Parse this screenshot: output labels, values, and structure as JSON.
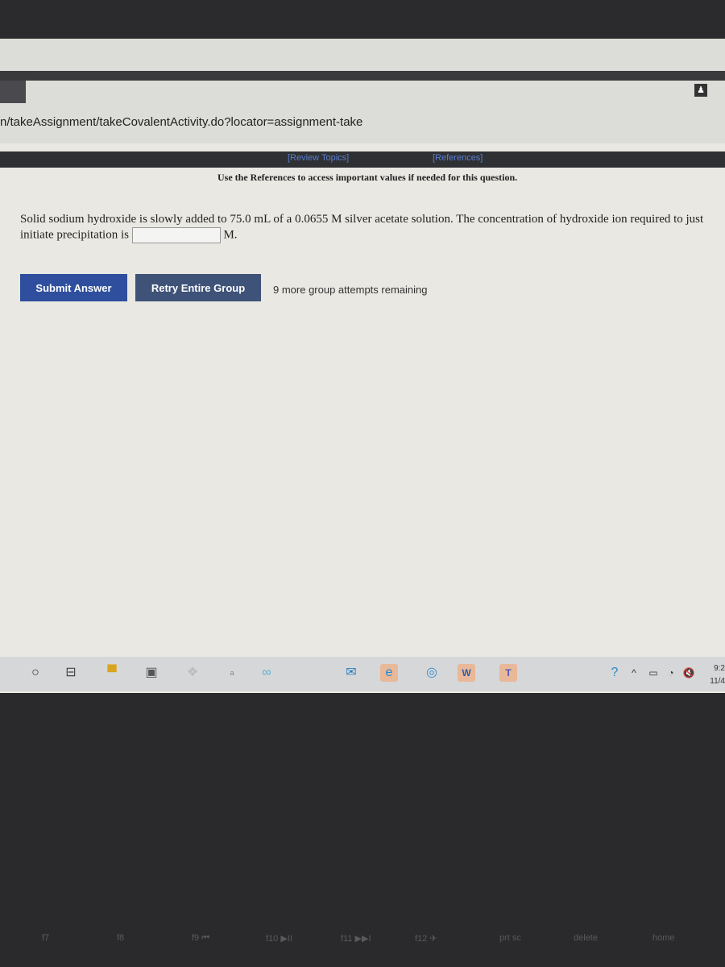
{
  "browser": {
    "url": "n/takeAssignment/takeCovalentActivity.do?locator=assignment-take"
  },
  "nav": {
    "review_topics": "[Review Topics]",
    "references": "[References]"
  },
  "notice": "Use the References to access important values if needed for this question.",
  "question": {
    "text": "Solid sodium hydroxide is slowly added to 75.0 mL of a 0.0655 M silver acetate solution. The concentration of hydroxide ion required to just initiate precipitation is",
    "answer_value": "",
    "unit": "M."
  },
  "buttons": {
    "submit": "Submit Answer",
    "retry": "Retry Entire Group"
  },
  "attempts": "9 more group attempts remaining",
  "taskbar": {
    "clock_time": "9:2",
    "clock_date": "11/4",
    "icons": [
      "cortana-icon",
      "task-view-icon",
      "file-explorer-icon",
      "store-icon",
      "dropbox-icon",
      "app-icon",
      "link-icon",
      "mail-icon",
      "edge-icon",
      "chrome-icon",
      "word-icon",
      "teams-icon"
    ]
  },
  "keyboard": {
    "keys": [
      "f7",
      "f8",
      "f9 ⏮",
      "f10 ▶II",
      "f11 ▶▶I",
      "f12 ✈",
      "prt sc",
      "delete",
      "home"
    ]
  },
  "colors": {
    "submit": "#2f4f9e",
    "retry": "#3f5378",
    "link": "#5a7fd0"
  }
}
